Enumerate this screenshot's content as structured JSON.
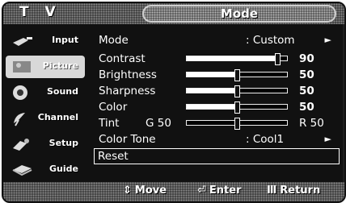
{
  "header": {
    "tv_label": "T V",
    "menu_title": "Mode"
  },
  "sidebar": {
    "items": [
      {
        "label": "Input",
        "icon": "input-plug-icon",
        "active": false
      },
      {
        "label": "Picture",
        "icon": "picture-icon",
        "active": true
      },
      {
        "label": "Sound",
        "icon": "speaker-icon",
        "active": false
      },
      {
        "label": "Channel",
        "icon": "satellite-dish-icon",
        "active": false
      },
      {
        "label": "Setup",
        "icon": "setup-icon",
        "active": false
      },
      {
        "label": "Guide",
        "icon": "guide-icon",
        "active": false
      }
    ]
  },
  "menu": {
    "mode": {
      "label": "Mode",
      "value": ": Custom",
      "arrow": "►"
    },
    "contrast": {
      "label": "Contrast",
      "value": "90",
      "level": 0.9
    },
    "brightness": {
      "label": "Brightness",
      "value": "50",
      "level": 0.5
    },
    "sharpness": {
      "label": "Sharpness",
      "value": "50",
      "level": 0.5
    },
    "color": {
      "label": "Color",
      "value": "50",
      "level": 0.5
    },
    "tint": {
      "label": "Tint",
      "left": "G 50",
      "right": "R 50",
      "level": 0.5
    },
    "color_tone": {
      "label": "Color Tone",
      "value": ": Cool1",
      "arrow": "►"
    },
    "reset": {
      "label": "Reset"
    }
  },
  "footer": {
    "move": {
      "glyph": "⇕",
      "label": "Move"
    },
    "enter": {
      "glyph": "⏎",
      "label": "Enter"
    },
    "return": {
      "glyph": "Ⅲ",
      "label": "Return"
    }
  }
}
